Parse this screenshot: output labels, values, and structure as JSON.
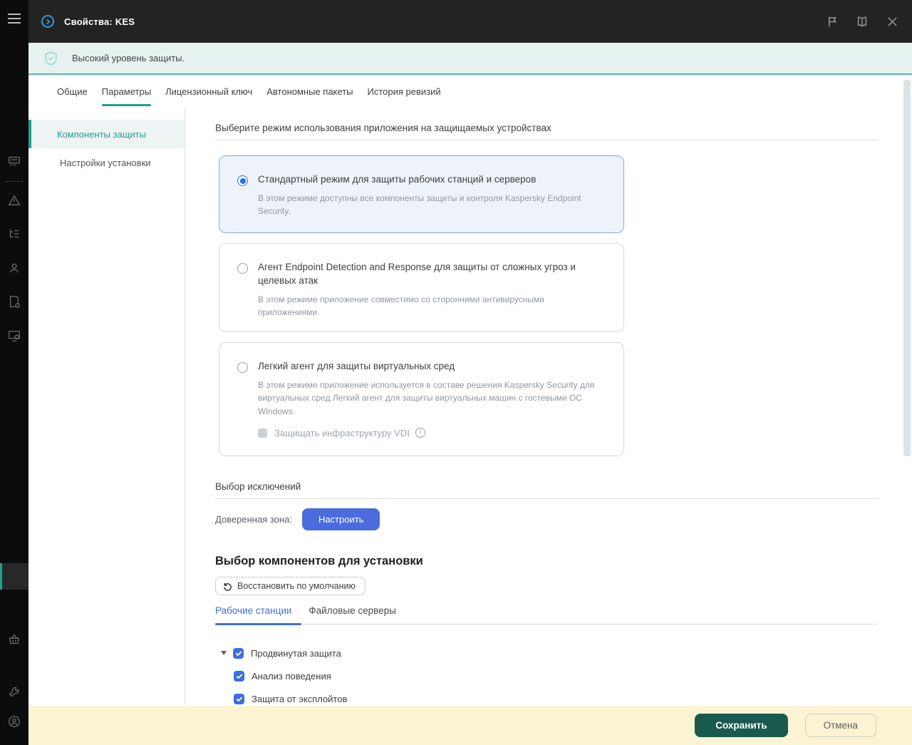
{
  "window": {
    "title": "Свойства: KES",
    "banner_text": "Высокий уровень защиты."
  },
  "tabs": {
    "active": "Параметры",
    "items": [
      {
        "label": "Общие"
      },
      {
        "label": "Параметры"
      },
      {
        "label": "Лицензионный ключ"
      },
      {
        "label": "Автономные пакеты"
      },
      {
        "label": "История ревизий"
      }
    ]
  },
  "sidebar": {
    "active": "Компоненты защиты",
    "items": [
      {
        "label": "Компоненты защиты"
      },
      {
        "label": "Настройки установки"
      }
    ]
  },
  "content": {
    "mode_section": {
      "heading": "Выберите режим использования приложения на защищаемых устройствах",
      "options": [
        {
          "title": "Стандартный режим для защиты рабочих станций и серверов",
          "description": "В этом режиме доступны все компоненты защиты и контроля Kaspersky Endpoint Security.",
          "selected": true
        },
        {
          "title": "Агент Endpoint Detection and Response для защиты от сложных угроз и целевых атак",
          "description": "В этом режиме приложение совместимо со сторонними антивирусными приложениями.",
          "selected": false
        },
        {
          "title": "Легкий агент для защиты виртуальных сред",
          "description": "В этом режиме приложение используется в составе решения Kaspersky Security для виртуальных сред Легкий агент для защиты виртуальных машин с гостевыми ОС Windows.",
          "selected": false,
          "vdi_checkbox_label": "Защищать инфраструктуру VDI",
          "vdi_checked": false
        }
      ]
    },
    "exclusions_section": {
      "heading": "Выбор исключений",
      "trusted_zone_label": "Доверенная зона:",
      "configure_button": "Настроить"
    },
    "components_section": {
      "heading": "Выбор компонентов для установки",
      "restore_button": "Восстановить по умолчанию",
      "active_subtab": "Рабочие станции",
      "subtabs": [
        {
          "label": "Рабочие станции"
        },
        {
          "label": "Файловые серверы"
        }
      ],
      "tree": [
        {
          "label": "Продвинутая защита",
          "checked": true,
          "expanded": true
        },
        {
          "label": "Анализ поведения",
          "checked": true
        },
        {
          "label": "Защита от эксплойтов",
          "checked": true
        }
      ]
    }
  },
  "footer": {
    "save_button": "Сохранить",
    "cancel_button": "Отмена"
  },
  "icons": {
    "expand_triangle": "▾",
    "restore": "↺",
    "info": "i"
  },
  "colors": {
    "accent_teal": "#1f9e8e",
    "accent_blue": "#3d6ede",
    "radio_blue": "#1a73e8",
    "selected_card_border": "#89a9ed",
    "selected_card_bg": "#eef2fb",
    "banner_bg": "#e5f2ef",
    "banner_border": "#5cb9ad",
    "configure_button_bg": "#4a6cdf",
    "save_button_bg": "#1a5a4e",
    "footer_bg": "#fbf3d2",
    "header_bg": "#232323",
    "rail_bg": "#0c0c0c"
  }
}
